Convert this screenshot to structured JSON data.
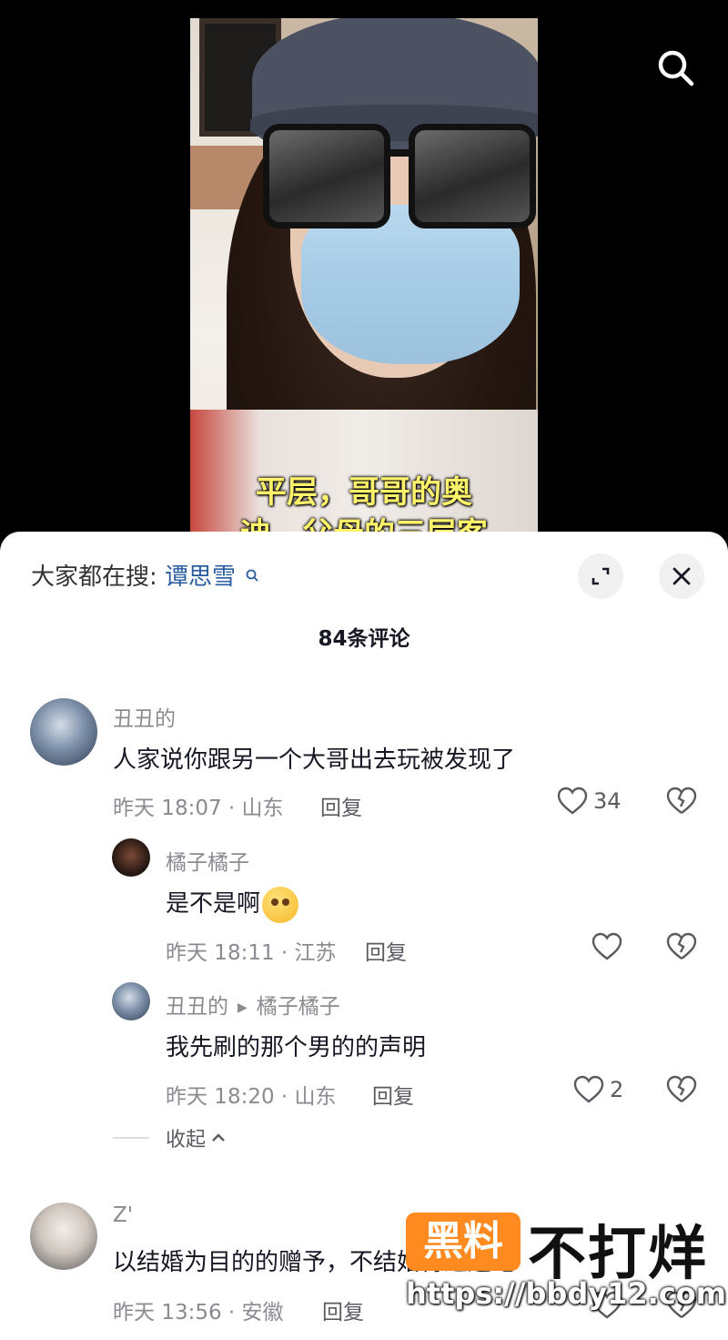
{
  "video": {
    "caption_line1": "平层，哥哥的奥",
    "caption_line2": "迪，父母的三层客"
  },
  "search_bar": {
    "prefix": "大家都在搜:",
    "keyword": "谭思雪"
  },
  "panel": {
    "comment_count": "84条评论"
  },
  "comments": [
    {
      "user": "丑丑的",
      "text": "人家说你跟另一个大哥出去玩被发现了",
      "meta": "昨天 18:07 · 山东",
      "reply_label": "回复",
      "likes": "34"
    },
    {
      "user": "橘子橘子",
      "text": "是不是啊",
      "meta": "昨天 18:11 · 江苏",
      "reply_label": "回复",
      "likes": ""
    },
    {
      "user": "丑丑的",
      "reply_to": "橘子橘子",
      "text": "我先刷的那个男的的声明",
      "meta": "昨天 18:20 · 山东",
      "reply_label": "回复",
      "likes": "2"
    },
    {
      "user": "Z'",
      "text": "以结婚为目的的赠予，不结婚得退还吧",
      "meta": "昨天 13:56 · 安徽",
      "reply_label": "回复",
      "likes": ""
    }
  ],
  "collapse_label": "收起",
  "watermark": {
    "badge": "黑料",
    "title": "不打烊",
    "url": "https://bbdy12.com"
  },
  "colors": {
    "caption": "#fff36b",
    "keyword": "#2a5d9f",
    "watermark_badge": "#ff8a1f"
  }
}
